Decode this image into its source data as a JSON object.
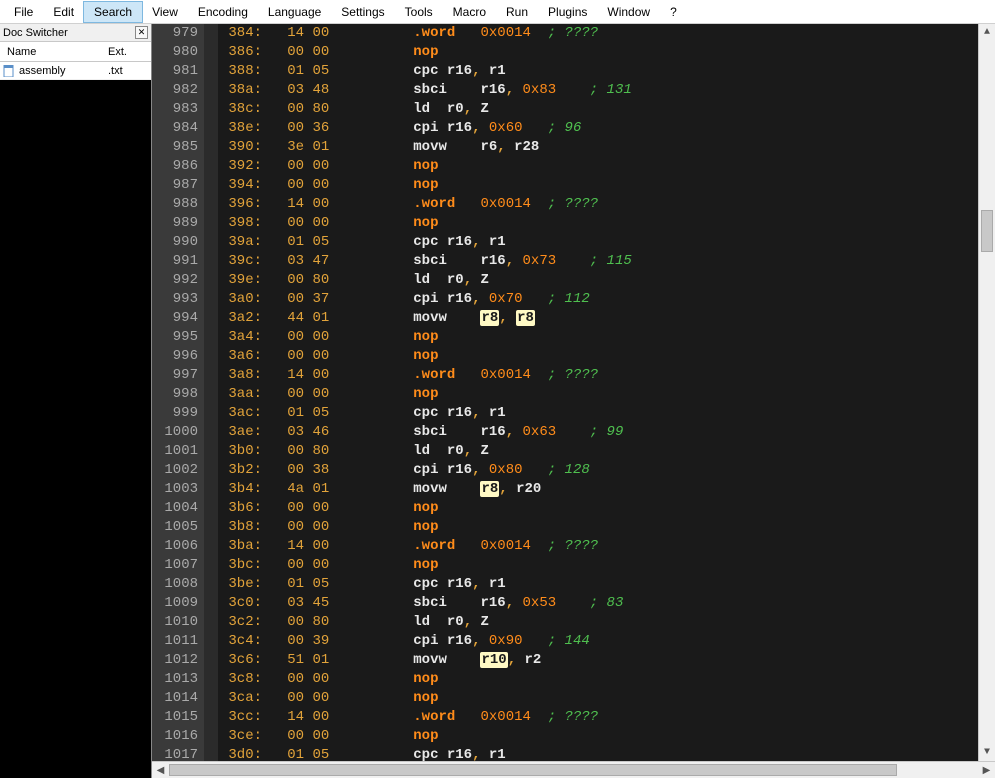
{
  "menubar": {
    "items": [
      "File",
      "Edit",
      "Search",
      "View",
      "Encoding",
      "Language",
      "Settings",
      "Tools",
      "Macro",
      "Run",
      "Plugins",
      "Window",
      "?"
    ],
    "active_index": 2
  },
  "doc_switcher": {
    "title": "Doc Switcher",
    "columns": {
      "name": "Name",
      "ext": "Ext."
    },
    "files": [
      {
        "name": "assembly",
        "ext": ".txt",
        "icon": "file-icon"
      }
    ]
  },
  "editor": {
    "highlight_tokens": [
      "r8",
      "r10"
    ],
    "lines": [
      {
        "n": 979,
        "addr": "384",
        "bytes": "14 00",
        "segments": [
          {
            "t": "kw",
            "v": ".word"
          },
          {
            "t": "sp",
            "v": "   "
          },
          {
            "t": "num",
            "v": "0x0014"
          },
          {
            "t": "sp",
            "v": "  "
          },
          {
            "t": "cmt",
            "v": "; ????"
          }
        ]
      },
      {
        "n": 980,
        "addr": "386",
        "bytes": "00 00",
        "segments": [
          {
            "t": "kw",
            "v": "nop"
          }
        ]
      },
      {
        "n": 981,
        "addr": "388",
        "bytes": "01 05",
        "segments": [
          {
            "t": "instr",
            "v": "cpc "
          },
          {
            "t": "reg",
            "v": "r16"
          },
          {
            "t": "punct",
            "v": ", "
          },
          {
            "t": "reg",
            "v": "r1"
          }
        ]
      },
      {
        "n": 982,
        "addr": "38a",
        "bytes": "03 48",
        "segments": [
          {
            "t": "instr",
            "v": "sbci"
          },
          {
            "t": "sp",
            "v": "    "
          },
          {
            "t": "reg",
            "v": "r16"
          },
          {
            "t": "punct",
            "v": ", "
          },
          {
            "t": "num",
            "v": "0x83"
          },
          {
            "t": "sp",
            "v": "    "
          },
          {
            "t": "cmt",
            "v": "; 131"
          }
        ]
      },
      {
        "n": 983,
        "addr": "38c",
        "bytes": "00 80",
        "segments": [
          {
            "t": "instr",
            "v": "ld  "
          },
          {
            "t": "reg",
            "v": "r0"
          },
          {
            "t": "punct",
            "v": ", "
          },
          {
            "t": "reg",
            "v": "Z"
          }
        ]
      },
      {
        "n": 984,
        "addr": "38e",
        "bytes": "00 36",
        "segments": [
          {
            "t": "instr",
            "v": "cpi "
          },
          {
            "t": "reg",
            "v": "r16"
          },
          {
            "t": "punct",
            "v": ", "
          },
          {
            "t": "num",
            "v": "0x60"
          },
          {
            "t": "sp",
            "v": "   "
          },
          {
            "t": "cmt",
            "v": "; 96"
          }
        ]
      },
      {
        "n": 985,
        "addr": "390",
        "bytes": "3e 01",
        "segments": [
          {
            "t": "instr",
            "v": "movw"
          },
          {
            "t": "sp",
            "v": "    "
          },
          {
            "t": "reg",
            "v": "r6"
          },
          {
            "t": "punct",
            "v": ", "
          },
          {
            "t": "reg",
            "v": "r28"
          }
        ]
      },
      {
        "n": 986,
        "addr": "392",
        "bytes": "00 00",
        "segments": [
          {
            "t": "kw",
            "v": "nop"
          }
        ]
      },
      {
        "n": 987,
        "addr": "394",
        "bytes": "00 00",
        "segments": [
          {
            "t": "kw",
            "v": "nop"
          }
        ]
      },
      {
        "n": 988,
        "addr": "396",
        "bytes": "14 00",
        "segments": [
          {
            "t": "kw",
            "v": ".word"
          },
          {
            "t": "sp",
            "v": "   "
          },
          {
            "t": "num",
            "v": "0x0014"
          },
          {
            "t": "sp",
            "v": "  "
          },
          {
            "t": "cmt",
            "v": "; ????"
          }
        ]
      },
      {
        "n": 989,
        "addr": "398",
        "bytes": "00 00",
        "segments": [
          {
            "t": "kw",
            "v": "nop"
          }
        ]
      },
      {
        "n": 990,
        "addr": "39a",
        "bytes": "01 05",
        "segments": [
          {
            "t": "instr",
            "v": "cpc "
          },
          {
            "t": "reg",
            "v": "r16"
          },
          {
            "t": "punct",
            "v": ", "
          },
          {
            "t": "reg",
            "v": "r1"
          }
        ]
      },
      {
        "n": 991,
        "addr": "39c",
        "bytes": "03 47",
        "segments": [
          {
            "t": "instr",
            "v": "sbci"
          },
          {
            "t": "sp",
            "v": "    "
          },
          {
            "t": "reg",
            "v": "r16"
          },
          {
            "t": "punct",
            "v": ", "
          },
          {
            "t": "num",
            "v": "0x73"
          },
          {
            "t": "sp",
            "v": "    "
          },
          {
            "t": "cmt",
            "v": "; 115"
          }
        ]
      },
      {
        "n": 992,
        "addr": "39e",
        "bytes": "00 80",
        "segments": [
          {
            "t": "instr",
            "v": "ld  "
          },
          {
            "t": "reg",
            "v": "r0"
          },
          {
            "t": "punct",
            "v": ", "
          },
          {
            "t": "reg",
            "v": "Z"
          }
        ]
      },
      {
        "n": 993,
        "addr": "3a0",
        "bytes": "00 37",
        "segments": [
          {
            "t": "instr",
            "v": "cpi "
          },
          {
            "t": "reg",
            "v": "r16"
          },
          {
            "t": "punct",
            "v": ", "
          },
          {
            "t": "num",
            "v": "0x70"
          },
          {
            "t": "sp",
            "v": "   "
          },
          {
            "t": "cmt",
            "v": "; 112"
          }
        ]
      },
      {
        "n": 994,
        "addr": "3a2",
        "bytes": "44 01",
        "segments": [
          {
            "t": "instr",
            "v": "movw"
          },
          {
            "t": "sp",
            "v": "    "
          },
          {
            "t": "sel",
            "v": "r8"
          },
          {
            "t": "punct",
            "v": ", "
          },
          {
            "t": "sel",
            "v": "r8"
          }
        ]
      },
      {
        "n": 995,
        "addr": "3a4",
        "bytes": "00 00",
        "segments": [
          {
            "t": "kw",
            "v": "nop"
          }
        ]
      },
      {
        "n": 996,
        "addr": "3a6",
        "bytes": "00 00",
        "segments": [
          {
            "t": "kw",
            "v": "nop"
          }
        ]
      },
      {
        "n": 997,
        "addr": "3a8",
        "bytes": "14 00",
        "segments": [
          {
            "t": "kw",
            "v": ".word"
          },
          {
            "t": "sp",
            "v": "   "
          },
          {
            "t": "num",
            "v": "0x0014"
          },
          {
            "t": "sp",
            "v": "  "
          },
          {
            "t": "cmt",
            "v": "; ????"
          }
        ]
      },
      {
        "n": 998,
        "addr": "3aa",
        "bytes": "00 00",
        "segments": [
          {
            "t": "kw",
            "v": "nop"
          }
        ]
      },
      {
        "n": 999,
        "addr": "3ac",
        "bytes": "01 05",
        "segments": [
          {
            "t": "instr",
            "v": "cpc "
          },
          {
            "t": "reg",
            "v": "r16"
          },
          {
            "t": "punct",
            "v": ", "
          },
          {
            "t": "reg",
            "v": "r1"
          }
        ]
      },
      {
        "n": 1000,
        "addr": "3ae",
        "bytes": "03 46",
        "segments": [
          {
            "t": "instr",
            "v": "sbci"
          },
          {
            "t": "sp",
            "v": "    "
          },
          {
            "t": "reg",
            "v": "r16"
          },
          {
            "t": "punct",
            "v": ", "
          },
          {
            "t": "num",
            "v": "0x63"
          },
          {
            "t": "sp",
            "v": "    "
          },
          {
            "t": "cmt",
            "v": "; 99"
          }
        ]
      },
      {
        "n": 1001,
        "addr": "3b0",
        "bytes": "00 80",
        "segments": [
          {
            "t": "instr",
            "v": "ld  "
          },
          {
            "t": "reg",
            "v": "r0"
          },
          {
            "t": "punct",
            "v": ", "
          },
          {
            "t": "reg",
            "v": "Z"
          }
        ]
      },
      {
        "n": 1002,
        "addr": "3b2",
        "bytes": "00 38",
        "segments": [
          {
            "t": "instr",
            "v": "cpi "
          },
          {
            "t": "reg",
            "v": "r16"
          },
          {
            "t": "punct",
            "v": ", "
          },
          {
            "t": "num",
            "v": "0x80"
          },
          {
            "t": "sp",
            "v": "   "
          },
          {
            "t": "cmt",
            "v": "; 128"
          }
        ]
      },
      {
        "n": 1003,
        "addr": "3b4",
        "bytes": "4a 01",
        "segments": [
          {
            "t": "instr",
            "v": "movw"
          },
          {
            "t": "sp",
            "v": "    "
          },
          {
            "t": "sel",
            "v": "r8"
          },
          {
            "t": "punct",
            "v": ", "
          },
          {
            "t": "reg",
            "v": "r20"
          }
        ]
      },
      {
        "n": 1004,
        "addr": "3b6",
        "bytes": "00 00",
        "segments": [
          {
            "t": "kw",
            "v": "nop"
          }
        ]
      },
      {
        "n": 1005,
        "addr": "3b8",
        "bytes": "00 00",
        "segments": [
          {
            "t": "kw",
            "v": "nop"
          }
        ]
      },
      {
        "n": 1006,
        "addr": "3ba",
        "bytes": "14 00",
        "segments": [
          {
            "t": "kw",
            "v": ".word"
          },
          {
            "t": "sp",
            "v": "   "
          },
          {
            "t": "num",
            "v": "0x0014"
          },
          {
            "t": "sp",
            "v": "  "
          },
          {
            "t": "cmt",
            "v": "; ????"
          }
        ]
      },
      {
        "n": 1007,
        "addr": "3bc",
        "bytes": "00 00",
        "segments": [
          {
            "t": "kw",
            "v": "nop"
          }
        ]
      },
      {
        "n": 1008,
        "addr": "3be",
        "bytes": "01 05",
        "segments": [
          {
            "t": "instr",
            "v": "cpc "
          },
          {
            "t": "reg",
            "v": "r16"
          },
          {
            "t": "punct",
            "v": ", "
          },
          {
            "t": "reg",
            "v": "r1"
          }
        ]
      },
      {
        "n": 1009,
        "addr": "3c0",
        "bytes": "03 45",
        "segments": [
          {
            "t": "instr",
            "v": "sbci"
          },
          {
            "t": "sp",
            "v": "    "
          },
          {
            "t": "reg",
            "v": "r16"
          },
          {
            "t": "punct",
            "v": ", "
          },
          {
            "t": "num",
            "v": "0x53"
          },
          {
            "t": "sp",
            "v": "    "
          },
          {
            "t": "cmt",
            "v": "; 83"
          }
        ]
      },
      {
        "n": 1010,
        "addr": "3c2",
        "bytes": "00 80",
        "segments": [
          {
            "t": "instr",
            "v": "ld  "
          },
          {
            "t": "reg",
            "v": "r0"
          },
          {
            "t": "punct",
            "v": ", "
          },
          {
            "t": "reg",
            "v": "Z"
          }
        ]
      },
      {
        "n": 1011,
        "addr": "3c4",
        "bytes": "00 39",
        "segments": [
          {
            "t": "instr",
            "v": "cpi "
          },
          {
            "t": "reg",
            "v": "r16"
          },
          {
            "t": "punct",
            "v": ", "
          },
          {
            "t": "num",
            "v": "0x90"
          },
          {
            "t": "sp",
            "v": "   "
          },
          {
            "t": "cmt",
            "v": "; 144"
          }
        ]
      },
      {
        "n": 1012,
        "addr": "3c6",
        "bytes": "51 01",
        "segments": [
          {
            "t": "instr",
            "v": "movw"
          },
          {
            "t": "sp",
            "v": "    "
          },
          {
            "t": "sel",
            "v": "r10"
          },
          {
            "t": "punct",
            "v": ", "
          },
          {
            "t": "reg",
            "v": "r2"
          }
        ]
      },
      {
        "n": 1013,
        "addr": "3c8",
        "bytes": "00 00",
        "segments": [
          {
            "t": "kw",
            "v": "nop"
          }
        ]
      },
      {
        "n": 1014,
        "addr": "3ca",
        "bytes": "00 00",
        "segments": [
          {
            "t": "kw",
            "v": "nop"
          }
        ]
      },
      {
        "n": 1015,
        "addr": "3cc",
        "bytes": "14 00",
        "segments": [
          {
            "t": "kw",
            "v": ".word"
          },
          {
            "t": "sp",
            "v": "   "
          },
          {
            "t": "num",
            "v": "0x0014"
          },
          {
            "t": "sp",
            "v": "  "
          },
          {
            "t": "cmt",
            "v": "; ????"
          }
        ]
      },
      {
        "n": 1016,
        "addr": "3ce",
        "bytes": "00 00",
        "segments": [
          {
            "t": "kw",
            "v": "nop"
          }
        ]
      },
      {
        "n": 1017,
        "addr": "3d0",
        "bytes": "01 05",
        "segments": [
          {
            "t": "instr",
            "v": "cpc "
          },
          {
            "t": "reg",
            "v": "r16"
          },
          {
            "t": "punct",
            "v": ", "
          },
          {
            "t": "reg",
            "v": "r1"
          }
        ]
      }
    ]
  },
  "scroll": {
    "v_thumb_top_pct": 24,
    "v_thumb_height_pct": 6,
    "h_thumb_left_pct": 0,
    "h_thumb_width_pct": 90
  }
}
